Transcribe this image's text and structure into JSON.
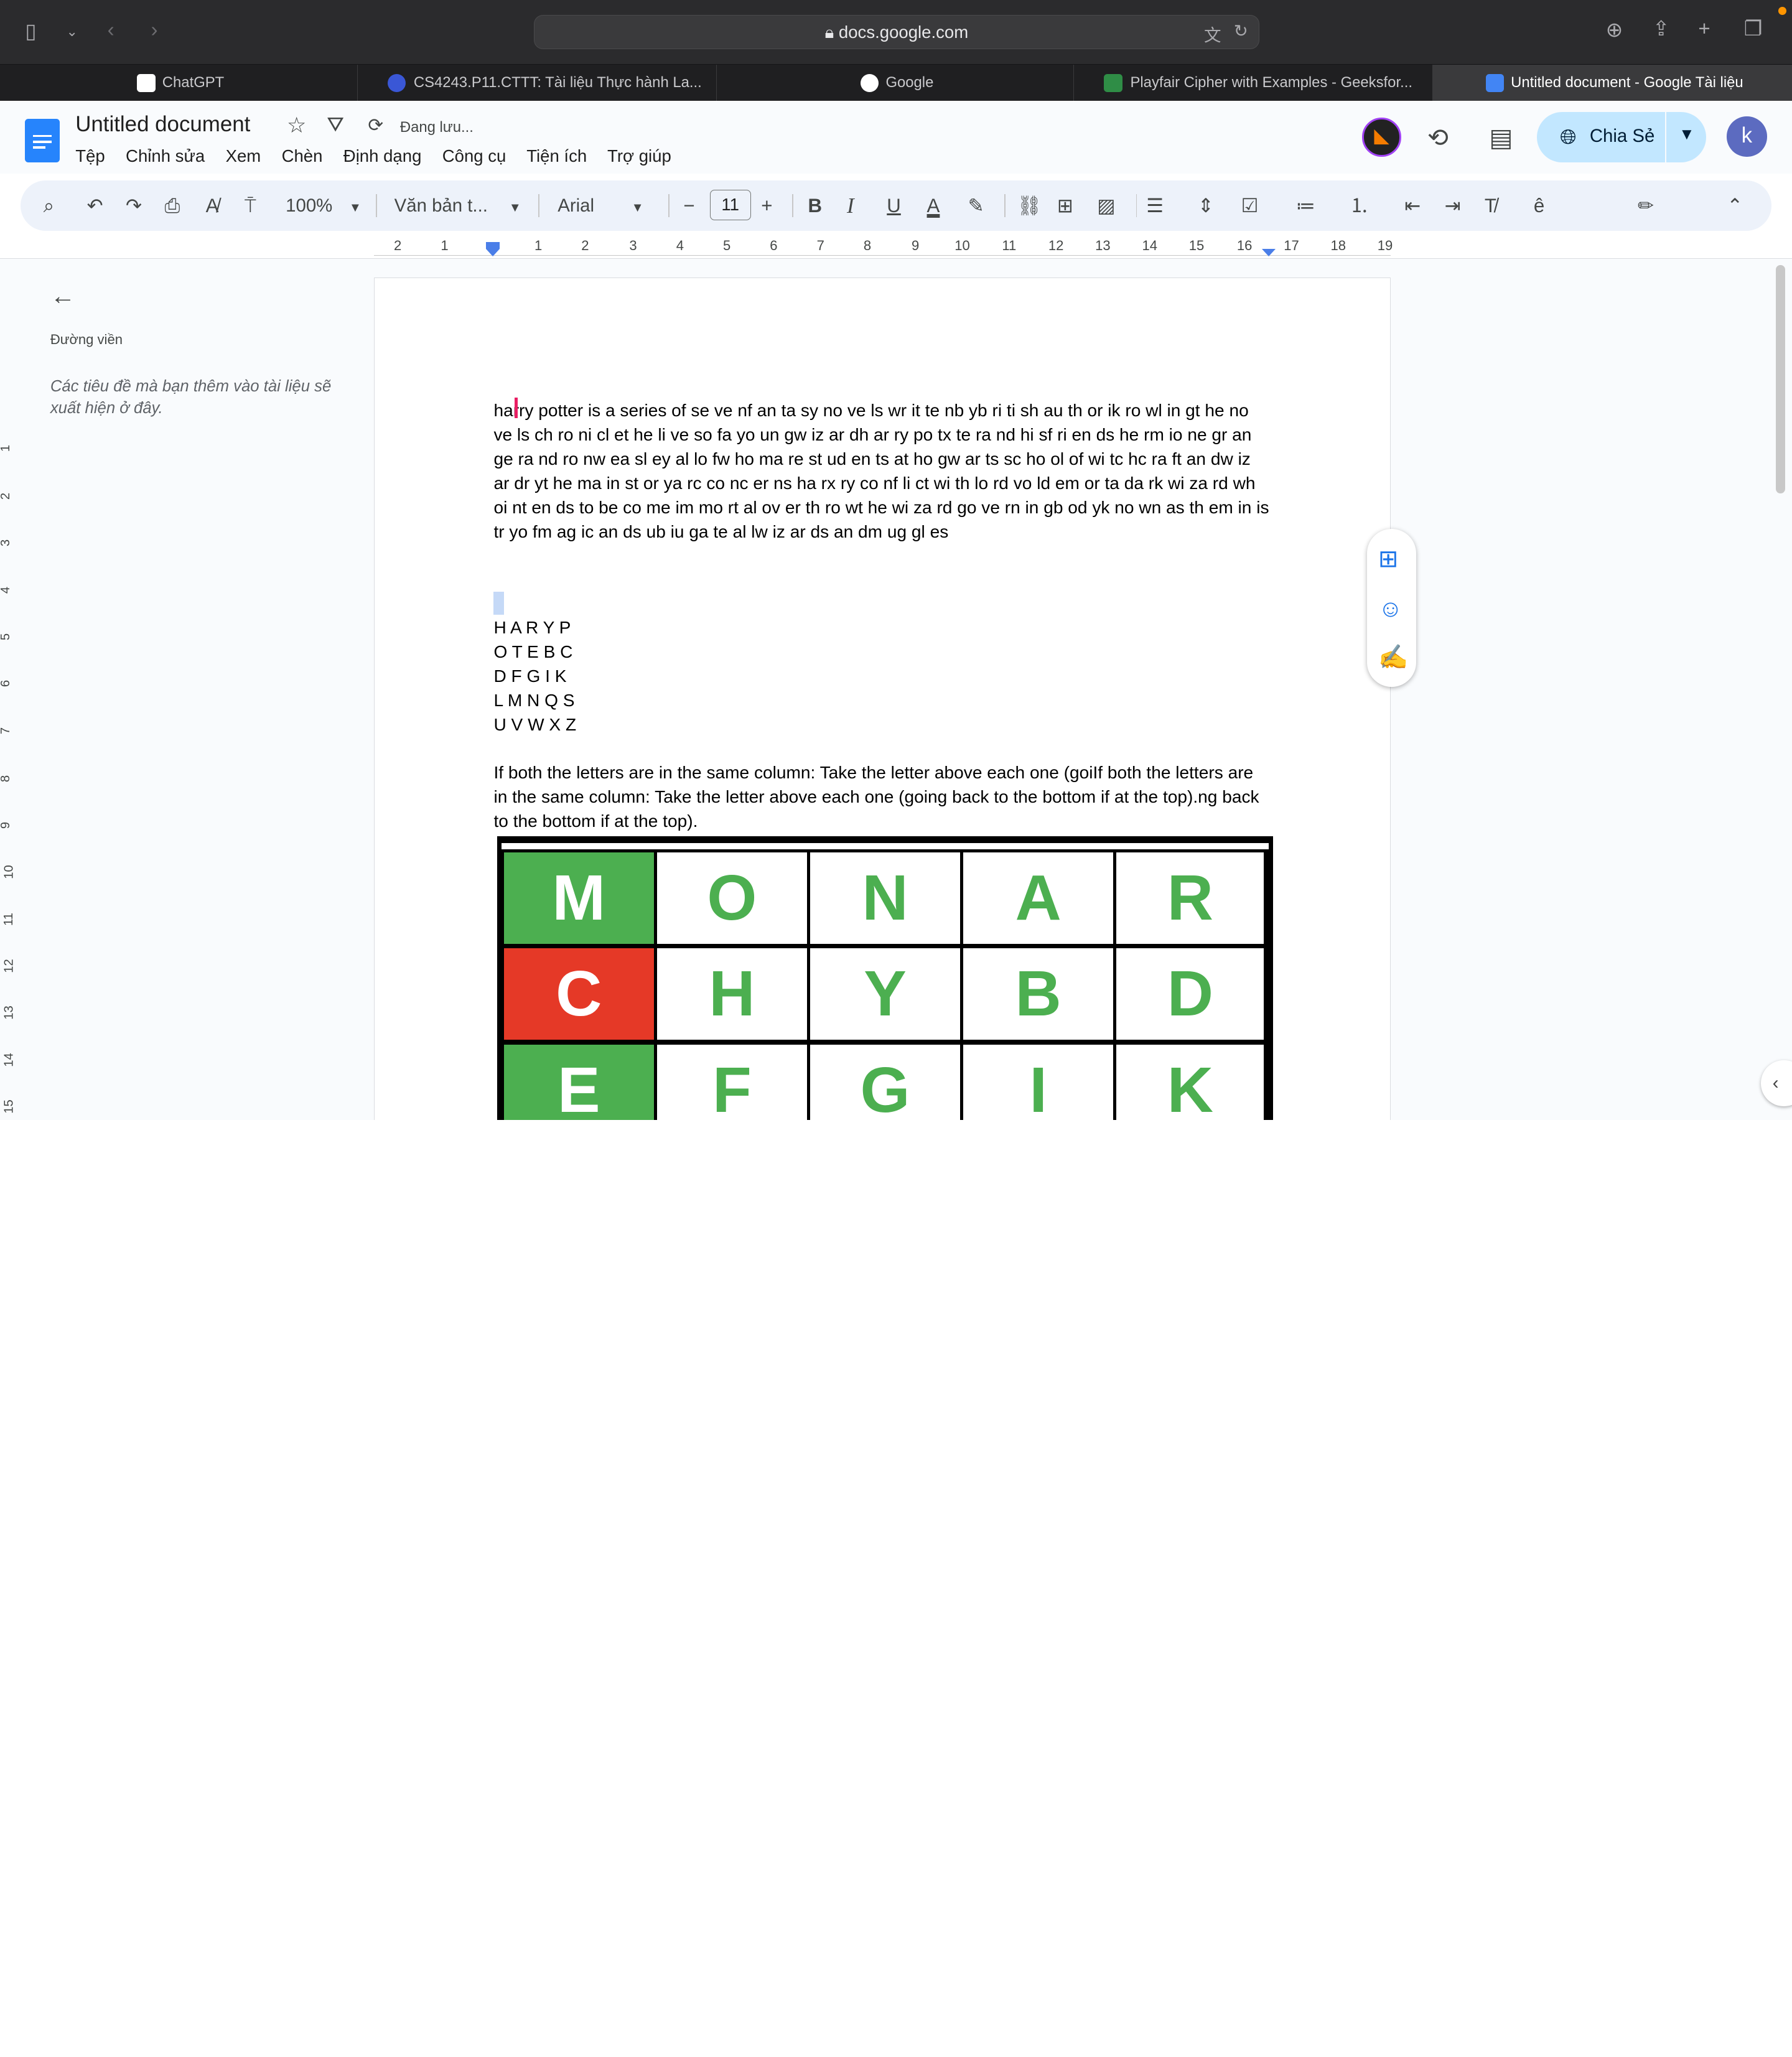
{
  "browser": {
    "url": "docs.google.com",
    "tabs": [
      {
        "title": "ChatGPT",
        "favicon_color": "#ffffff"
      },
      {
        "title": "CS4243.P11.CTTT: Tài liệu Thực hành La...",
        "favicon_color": "#3a57d6"
      },
      {
        "title": "Google",
        "favicon_color": "#ffffff"
      },
      {
        "title": "Playfair Cipher with Examples - Geeksfor...",
        "favicon_color": "#2f8d46"
      },
      {
        "title": "Untitled document - Google Tài liệu",
        "favicon_color": "#4285f4"
      }
    ],
    "active_tab": 4
  },
  "docs": {
    "title": "Untitled document",
    "saving_status": "Đang lưu...",
    "menu": [
      "Tệp",
      "Chỉnh sửa",
      "Xem",
      "Chèn",
      "Định dạng",
      "Công cụ",
      "Tiện ích",
      "Trợ giúp"
    ],
    "share_label": "Chia Sẻ",
    "avatar_letter": "k",
    "accent": "#c2e7ff"
  },
  "toolbar": {
    "zoom": "100%",
    "style": "Văn bản t...",
    "font": "Arial",
    "font_size": "11"
  },
  "ruler": {
    "labels": [
      "2",
      "1",
      "1",
      "2",
      "3",
      "4",
      "5",
      "6",
      "7",
      "8",
      "9",
      "10",
      "11",
      "12",
      "13",
      "14",
      "15",
      "16",
      "17",
      "18",
      "19"
    ]
  },
  "vruler": {
    "labels": [
      "1",
      "2",
      "3",
      "4",
      "5",
      "6",
      "7",
      "8",
      "9",
      "10",
      "11",
      "12",
      "13",
      "14",
      "15"
    ]
  },
  "outline": {
    "title": "Đường viền",
    "hint": "Các tiêu đề mà bạn thêm vào tài liệu sẽ xuất hiện ở đây."
  },
  "document": {
    "paragraph1": "harry potter is a series of se ve nf an ta sy no ve ls wr it te nb yb ri ti sh au th or ik ro wl in gt he no ve ls ch ro ni cl et he li ve so fa yo un gw iz ar dh ar ry po tx te ra nd hi sf ri en ds he rm io ne gr an ge ra nd ro nw ea sl ey al lo fw ho ma re st ud en ts at ho gw ar ts sc ho ol of wi tc hc ra ft an dw iz ar dr yt he ma in st or ya rc co nc er ns ha rx ry co nf li ct wi th lo rd vo ld em or ta da rk wi za rd wh oi nt en ds to be co me im mo rt al ov er th ro wt he wi za rd go ve rn in gb od yk no wn as th em in is tr yo fm ag ic an ds ub iu ga te al lw iz ar ds an dm ug gl es",
    "grid_rows": [
      "H A R Y P",
      "O T E B C",
      "D F G I K",
      "L M N Q S",
      "U V W X Z"
    ],
    "rule_text": "If both the letters are in the same column: Take the letter above each one (goiIf both the letters are in the same column: Take the letter above each one (going back to the bottom if at the top).ng back to the bottom if at the top).",
    "table_rows": [
      [
        "M",
        "O",
        "N",
        "A",
        "R"
      ],
      [
        "C",
        "H",
        "Y",
        "B",
        "D"
      ],
      [
        "E",
        "F",
        "G",
        "I",
        "K"
      ]
    ]
  }
}
